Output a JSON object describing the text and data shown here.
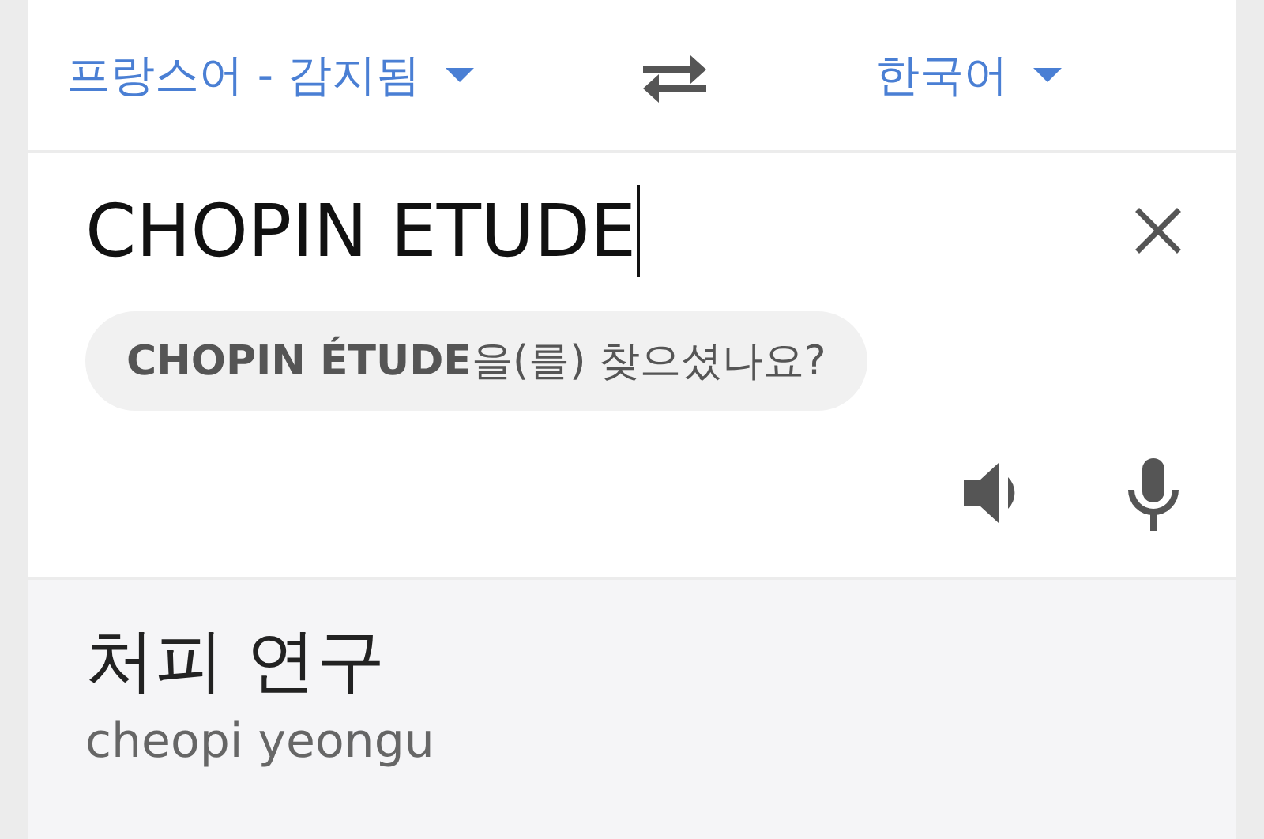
{
  "languages": {
    "source": "프랑스어 - 감지됨",
    "target": "한국어"
  },
  "input": {
    "value": "CHOPIN ETUDE",
    "suggestion": "**CHOPIN ÉTUDE**을(를) 찾으셨나요?"
  },
  "result": {
    "translation": "처피 연구",
    "romanization": "cheopi yeongu"
  }
}
